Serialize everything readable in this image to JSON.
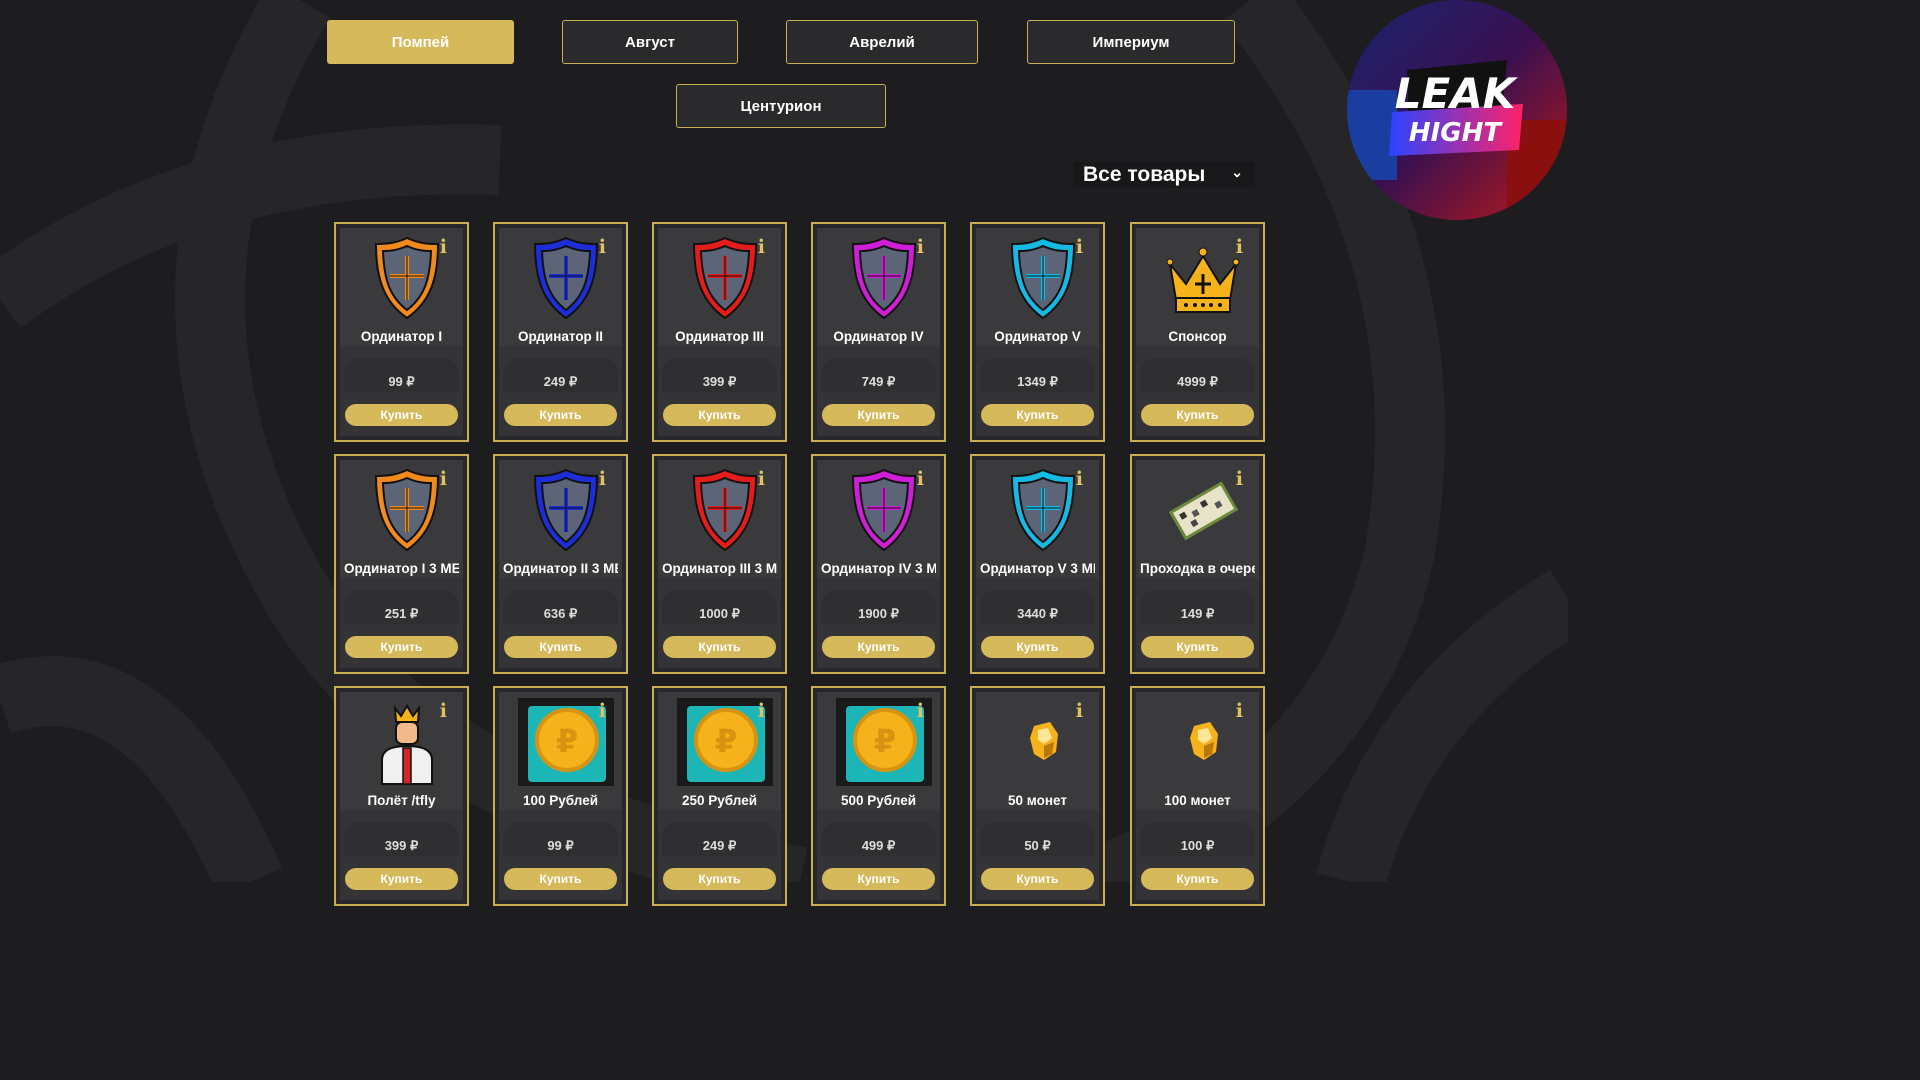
{
  "tabs": [
    {
      "label": "Помпей",
      "active": true
    },
    {
      "label": "Август",
      "active": false
    },
    {
      "label": "Аврелий",
      "active": false
    },
    {
      "label": "Империум",
      "active": false
    },
    {
      "label": "Центурион",
      "active": false
    }
  ],
  "filter": {
    "selected": "Все товары"
  },
  "logo": {
    "line1": "LEAK",
    "line2": "HIGHT"
  },
  "colors": {
    "accent": "#d6b95a",
    "background": "#1d1d20",
    "card": "#3a3a3d"
  },
  "products": [
    {
      "name": "Ординатор I",
      "price": "99 ₽",
      "buy": "Купить",
      "info": "i",
      "icon": "shield-orange-icon",
      "color": "#f08a1c"
    },
    {
      "name": "Ординатор II",
      "price": "249 ₽",
      "buy": "Купить",
      "info": "i",
      "icon": "shield-blue-icon",
      "color": "#1d2ed8"
    },
    {
      "name": "Ординатор III",
      "price": "399 ₽",
      "buy": "Купить",
      "info": "i",
      "icon": "shield-red-icon",
      "color": "#e51c1c"
    },
    {
      "name": "Ординатор IV",
      "price": "749 ₽",
      "buy": "Купить",
      "info": "i",
      "icon": "shield-magenta-icon",
      "color": "#d01ed8"
    },
    {
      "name": "Ординатор V",
      "price": "1349 ₽",
      "buy": "Купить",
      "info": "i",
      "icon": "shield-cyan-icon",
      "color": "#16b8e4"
    },
    {
      "name": "Спонсор",
      "price": "4999 ₽",
      "buy": "Купить",
      "info": "i",
      "icon": "crown-icon",
      "color": "#f5b21a"
    },
    {
      "name": "Ординатор I 3 МЕ",
      "price": "251 ₽",
      "buy": "Купить",
      "info": "i",
      "icon": "shield-orange-icon",
      "color": "#f08a1c"
    },
    {
      "name": "Ординатор II 3 МЕ",
      "price": "636 ₽",
      "buy": "Купить",
      "info": "i",
      "icon": "shield-blue-icon",
      "color": "#1d2ed8"
    },
    {
      "name": "Ординатор III 3 М",
      "price": "1000 ₽",
      "buy": "Купить",
      "info": "i",
      "icon": "shield-red-icon",
      "color": "#e51c1c"
    },
    {
      "name": "Ординатор IV 3 М",
      "price": "1900 ₽",
      "buy": "Купить",
      "info": "i",
      "icon": "shield-magenta-icon",
      "color": "#d01ed8"
    },
    {
      "name": "Ординатор V 3 МЕ",
      "price": "3440 ₽",
      "buy": "Купить",
      "info": "i",
      "icon": "shield-cyan-icon",
      "color": "#16b8e4"
    },
    {
      "name": "Проходка в очере",
      "price": "149 ₽",
      "buy": "Купить",
      "info": "i",
      "icon": "queue-pass-icon",
      "color": "#e8e2c8"
    },
    {
      "name": "Полёт /tfly",
      "price": "399 ₽",
      "buy": "Купить",
      "info": "i",
      "icon": "king-person-icon",
      "color": "#f5b21a"
    },
    {
      "name": "100 Рублей",
      "price": "99 ₽",
      "buy": "Купить",
      "info": "i",
      "icon": "ruble-coin-icon",
      "color": "#1cb6b6"
    },
    {
      "name": "250 Рублей",
      "price": "249 ₽",
      "buy": "Купить",
      "info": "i",
      "icon": "ruble-coin-icon",
      "color": "#1cb6b6"
    },
    {
      "name": "500 Рублей",
      "price": "499 ₽",
      "buy": "Купить",
      "info": "i",
      "icon": "ruble-coin-icon",
      "color": "#1cb6b6"
    },
    {
      "name": "50 монет",
      "price": "50 ₽",
      "buy": "Купить",
      "info": "i",
      "icon": "gold-nugget-icon",
      "color": "#f5b21a"
    },
    {
      "name": "100 монет",
      "price": "100 ₽",
      "buy": "Купить",
      "info": "i",
      "icon": "gold-nugget-icon",
      "color": "#f5b21a"
    }
  ]
}
